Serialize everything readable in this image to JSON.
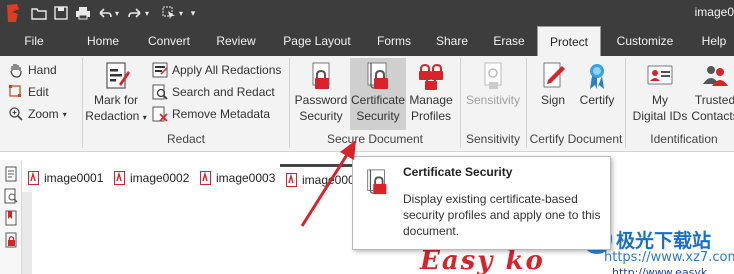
{
  "titlebar": {
    "title": "image0"
  },
  "menu": {
    "tabs": [
      "File",
      "Home",
      "Convert",
      "Review",
      "Page Layout",
      "Forms",
      "Share",
      "Erase",
      "Protect",
      "Customize",
      "Help"
    ],
    "active": "Protect"
  },
  "ribbon": {
    "navigation": {
      "hand": "Hand",
      "edit": "Edit",
      "zoom": "Zoom"
    },
    "redact": {
      "group_label": "Redact",
      "mark_for": "Mark for",
      "redaction": "Redaction",
      "apply_all": "Apply All Redactions",
      "search_and_redact": "Search and Redact",
      "remove_metadata": "Remove Metadata"
    },
    "secure_document": {
      "group_label": "Secure Document",
      "password_1": "Password",
      "password_2": "Security",
      "certificate_1": "Certificate",
      "certificate_2": "Security",
      "manage_1": "Manage",
      "manage_2": "Profiles"
    },
    "sensitivity": {
      "group_label": "Sensitivity",
      "button": "Sensitivity"
    },
    "certify_document": {
      "group_label": "Certify Document",
      "sign": "Sign",
      "certify": "Certify"
    },
    "identification": {
      "group_label": "Identification",
      "my_ids_1": "My",
      "my_ids_2": "Digital IDs",
      "trusted_1": "Trusted",
      "trusted_2": "Contacts"
    }
  },
  "document_tabs": [
    "image0001",
    "image0002",
    "image0003",
    "image000"
  ],
  "tooltip": {
    "title": "Certificate Security",
    "body": "Display existing certificate-based security profiles and apply one to this document."
  },
  "watermark": {
    "cn": "极光下载站",
    "url": "https://www.xz7.com",
    "red_text": "Easy ko",
    "url2": "http://www.easyk"
  },
  "colors": {
    "chrome": "#3d3d3d",
    "ribbon": "#f3f3f3",
    "accent_red": "#d8232a",
    "hover": "#cfcfcf"
  }
}
